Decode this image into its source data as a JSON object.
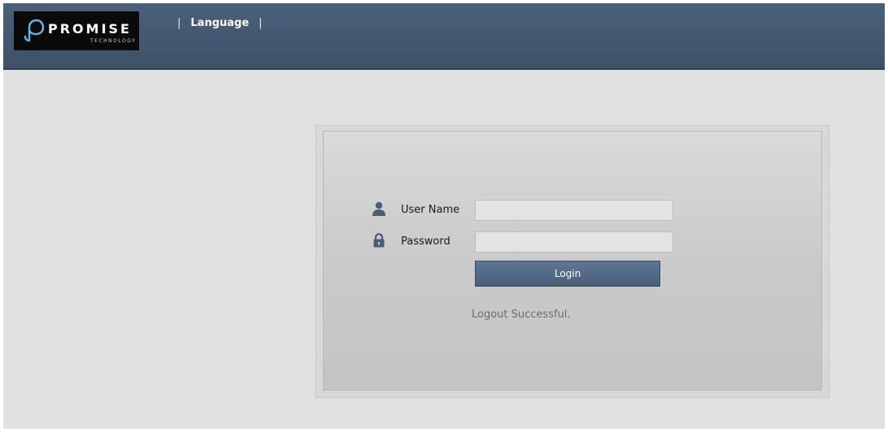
{
  "brand": {
    "name": "PROMISE",
    "tagline": "TECHNOLOGY"
  },
  "topnav": {
    "language_label": "Language"
  },
  "login": {
    "username_label": "User Name",
    "username_value": "",
    "password_label": "Password",
    "password_value": "",
    "submit_label": "Login",
    "status_message": "Logout Successful."
  },
  "icons": {
    "brand": "promise-logo-mark-icon",
    "username": "user-icon",
    "password": "lock-icon"
  },
  "colors": {
    "header": "#445a74",
    "background": "#e0e0e0",
    "button": "#51667f",
    "status_text": "#6b6b6b"
  }
}
